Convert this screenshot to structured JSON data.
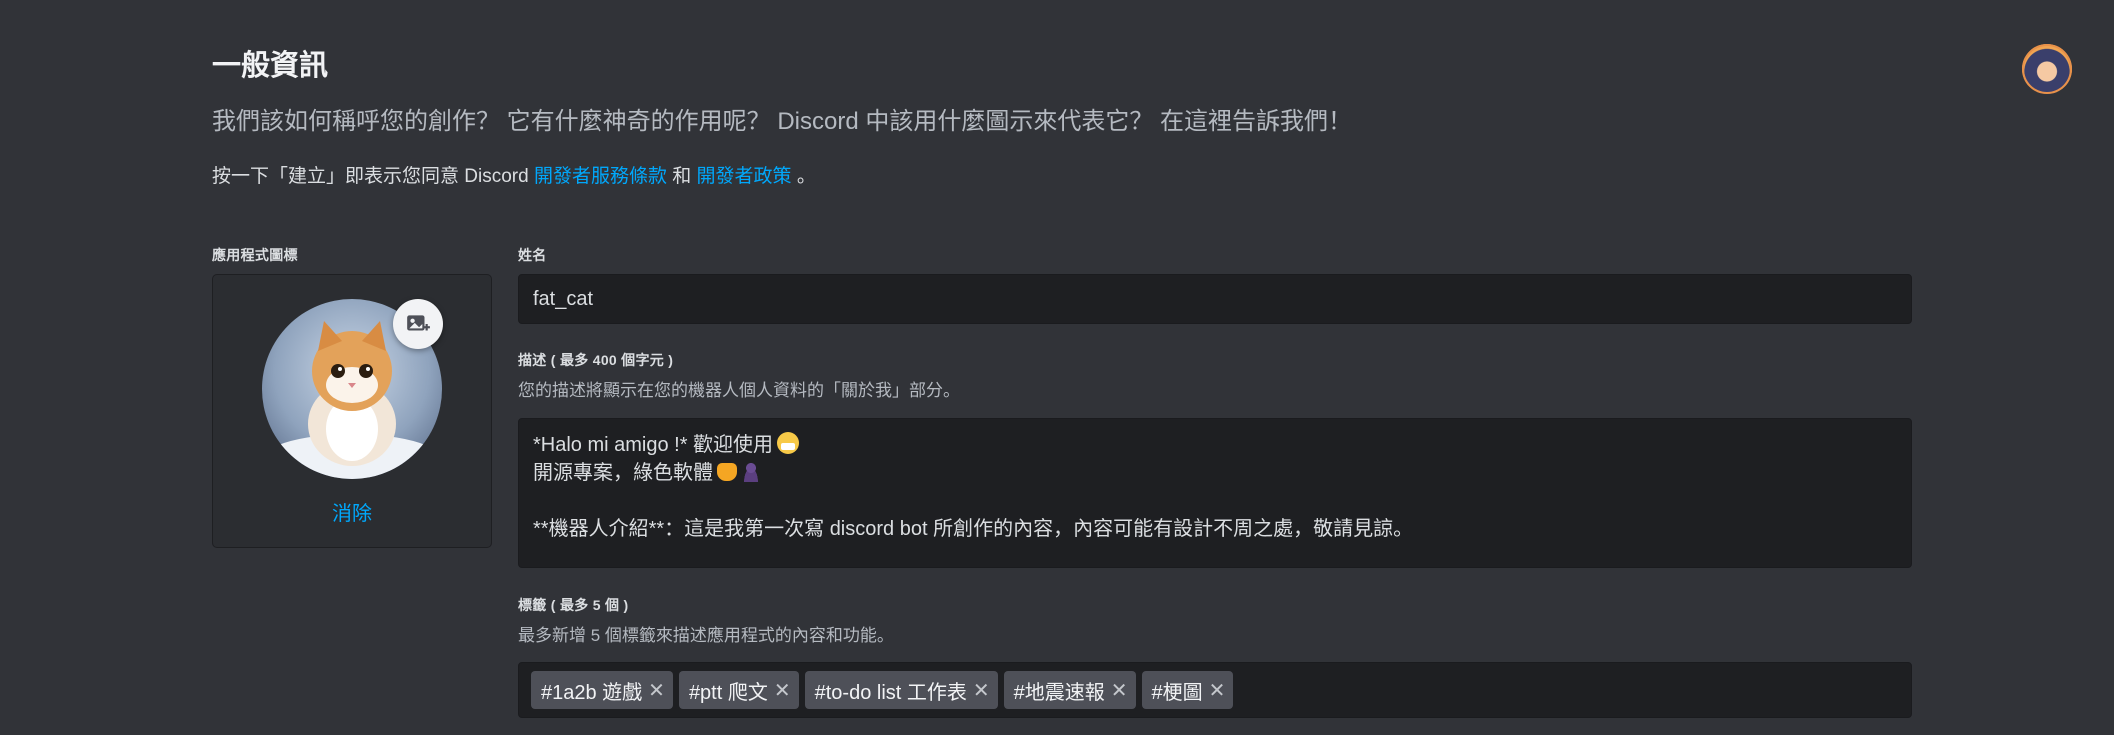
{
  "header": {
    "title": "一般資訊",
    "subtitle": "我們該如何稱呼您的創作？ 它有什麼神奇的作用呢？ Discord 中該用什麼圖示來代表它？ 在這裡告訴我們！",
    "terms": {
      "prefix": "按一下「建立」即表示您同意 Discord ",
      "tos_link": "開發者服務條款",
      "middle": " 和 ",
      "policy_link": "開發者政策",
      "suffix": " 。"
    }
  },
  "app_icon": {
    "label": "應用程式圖標",
    "remove_label": "消除"
  },
  "name_field": {
    "label": "姓名",
    "value": "fat_cat"
  },
  "description_field": {
    "label": "描述 ( 最多 400 個字元 )",
    "hint": "您的描述將顯示在您的機器人個人資料的「關於我」部分。",
    "lines": [
      "*Halo mi amigo !* 歡迎使用",
      "開源專案，綠色軟體",
      "",
      "**機器人介紹**：這是我第一次寫 discord bot 所創作的內容，內容可能有設計不周之處，敬請見諒。"
    ]
  },
  "tags_field": {
    "label": "標籤 ( 最多 5 個 )",
    "hint": "最多新增 5 個標籤來描述應用程式的內容和功能。",
    "tags": [
      "#1a2b 遊戲",
      "#ptt 爬文",
      "#to-do list 工作表",
      "#地震速報",
      "#梗圖"
    ],
    "remove_glyph": "✕"
  },
  "colors": {
    "background": "#313338",
    "input_background": "#1e1f22",
    "link": "#00a8fc",
    "tag_chip": "#4e5058"
  }
}
